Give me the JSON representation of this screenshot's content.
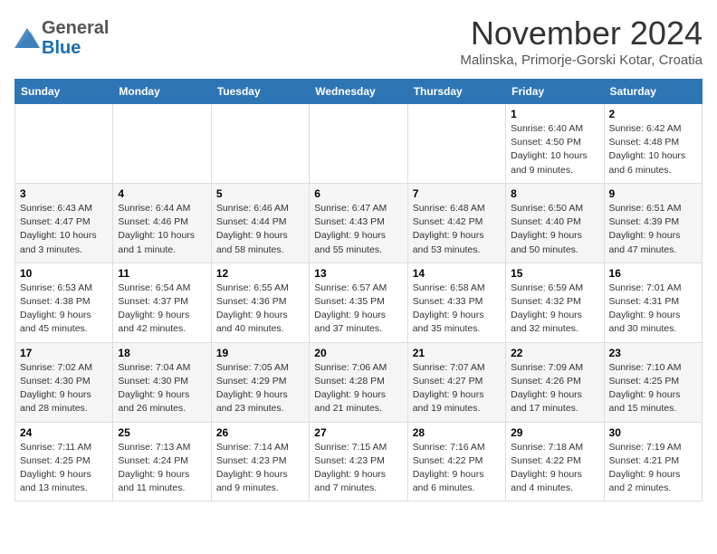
{
  "header": {
    "logo_general": "General",
    "logo_blue": "Blue",
    "month_title": "November 2024",
    "subtitle": "Malinska, Primorje-Gorski Kotar, Croatia"
  },
  "columns": [
    "Sunday",
    "Monday",
    "Tuesday",
    "Wednesday",
    "Thursday",
    "Friday",
    "Saturday"
  ],
  "weeks": [
    {
      "days": [
        {
          "num": "",
          "info": ""
        },
        {
          "num": "",
          "info": ""
        },
        {
          "num": "",
          "info": ""
        },
        {
          "num": "",
          "info": ""
        },
        {
          "num": "",
          "info": ""
        },
        {
          "num": "1",
          "info": "Sunrise: 6:40 AM\nSunset: 4:50 PM\nDaylight: 10 hours and 9 minutes."
        },
        {
          "num": "2",
          "info": "Sunrise: 6:42 AM\nSunset: 4:48 PM\nDaylight: 10 hours and 6 minutes."
        }
      ]
    },
    {
      "days": [
        {
          "num": "3",
          "info": "Sunrise: 6:43 AM\nSunset: 4:47 PM\nDaylight: 10 hours and 3 minutes."
        },
        {
          "num": "4",
          "info": "Sunrise: 6:44 AM\nSunset: 4:46 PM\nDaylight: 10 hours and 1 minute."
        },
        {
          "num": "5",
          "info": "Sunrise: 6:46 AM\nSunset: 4:44 PM\nDaylight: 9 hours and 58 minutes."
        },
        {
          "num": "6",
          "info": "Sunrise: 6:47 AM\nSunset: 4:43 PM\nDaylight: 9 hours and 55 minutes."
        },
        {
          "num": "7",
          "info": "Sunrise: 6:48 AM\nSunset: 4:42 PM\nDaylight: 9 hours and 53 minutes."
        },
        {
          "num": "8",
          "info": "Sunrise: 6:50 AM\nSunset: 4:40 PM\nDaylight: 9 hours and 50 minutes."
        },
        {
          "num": "9",
          "info": "Sunrise: 6:51 AM\nSunset: 4:39 PM\nDaylight: 9 hours and 47 minutes."
        }
      ]
    },
    {
      "days": [
        {
          "num": "10",
          "info": "Sunrise: 6:53 AM\nSunset: 4:38 PM\nDaylight: 9 hours and 45 minutes."
        },
        {
          "num": "11",
          "info": "Sunrise: 6:54 AM\nSunset: 4:37 PM\nDaylight: 9 hours and 42 minutes."
        },
        {
          "num": "12",
          "info": "Sunrise: 6:55 AM\nSunset: 4:36 PM\nDaylight: 9 hours and 40 minutes."
        },
        {
          "num": "13",
          "info": "Sunrise: 6:57 AM\nSunset: 4:35 PM\nDaylight: 9 hours and 37 minutes."
        },
        {
          "num": "14",
          "info": "Sunrise: 6:58 AM\nSunset: 4:33 PM\nDaylight: 9 hours and 35 minutes."
        },
        {
          "num": "15",
          "info": "Sunrise: 6:59 AM\nSunset: 4:32 PM\nDaylight: 9 hours and 32 minutes."
        },
        {
          "num": "16",
          "info": "Sunrise: 7:01 AM\nSunset: 4:31 PM\nDaylight: 9 hours and 30 minutes."
        }
      ]
    },
    {
      "days": [
        {
          "num": "17",
          "info": "Sunrise: 7:02 AM\nSunset: 4:30 PM\nDaylight: 9 hours and 28 minutes."
        },
        {
          "num": "18",
          "info": "Sunrise: 7:04 AM\nSunset: 4:30 PM\nDaylight: 9 hours and 26 minutes."
        },
        {
          "num": "19",
          "info": "Sunrise: 7:05 AM\nSunset: 4:29 PM\nDaylight: 9 hours and 23 minutes."
        },
        {
          "num": "20",
          "info": "Sunrise: 7:06 AM\nSunset: 4:28 PM\nDaylight: 9 hours and 21 minutes."
        },
        {
          "num": "21",
          "info": "Sunrise: 7:07 AM\nSunset: 4:27 PM\nDaylight: 9 hours and 19 minutes."
        },
        {
          "num": "22",
          "info": "Sunrise: 7:09 AM\nSunset: 4:26 PM\nDaylight: 9 hours and 17 minutes."
        },
        {
          "num": "23",
          "info": "Sunrise: 7:10 AM\nSunset: 4:25 PM\nDaylight: 9 hours and 15 minutes."
        }
      ]
    },
    {
      "days": [
        {
          "num": "24",
          "info": "Sunrise: 7:11 AM\nSunset: 4:25 PM\nDaylight: 9 hours and 13 minutes."
        },
        {
          "num": "25",
          "info": "Sunrise: 7:13 AM\nSunset: 4:24 PM\nDaylight: 9 hours and 11 minutes."
        },
        {
          "num": "26",
          "info": "Sunrise: 7:14 AM\nSunset: 4:23 PM\nDaylight: 9 hours and 9 minutes."
        },
        {
          "num": "27",
          "info": "Sunrise: 7:15 AM\nSunset: 4:23 PM\nDaylight: 9 hours and 7 minutes."
        },
        {
          "num": "28",
          "info": "Sunrise: 7:16 AM\nSunset: 4:22 PM\nDaylight: 9 hours and 6 minutes."
        },
        {
          "num": "29",
          "info": "Sunrise: 7:18 AM\nSunset: 4:22 PM\nDaylight: 9 hours and 4 minutes."
        },
        {
          "num": "30",
          "info": "Sunrise: 7:19 AM\nSunset: 4:21 PM\nDaylight: 9 hours and 2 minutes."
        }
      ]
    }
  ]
}
